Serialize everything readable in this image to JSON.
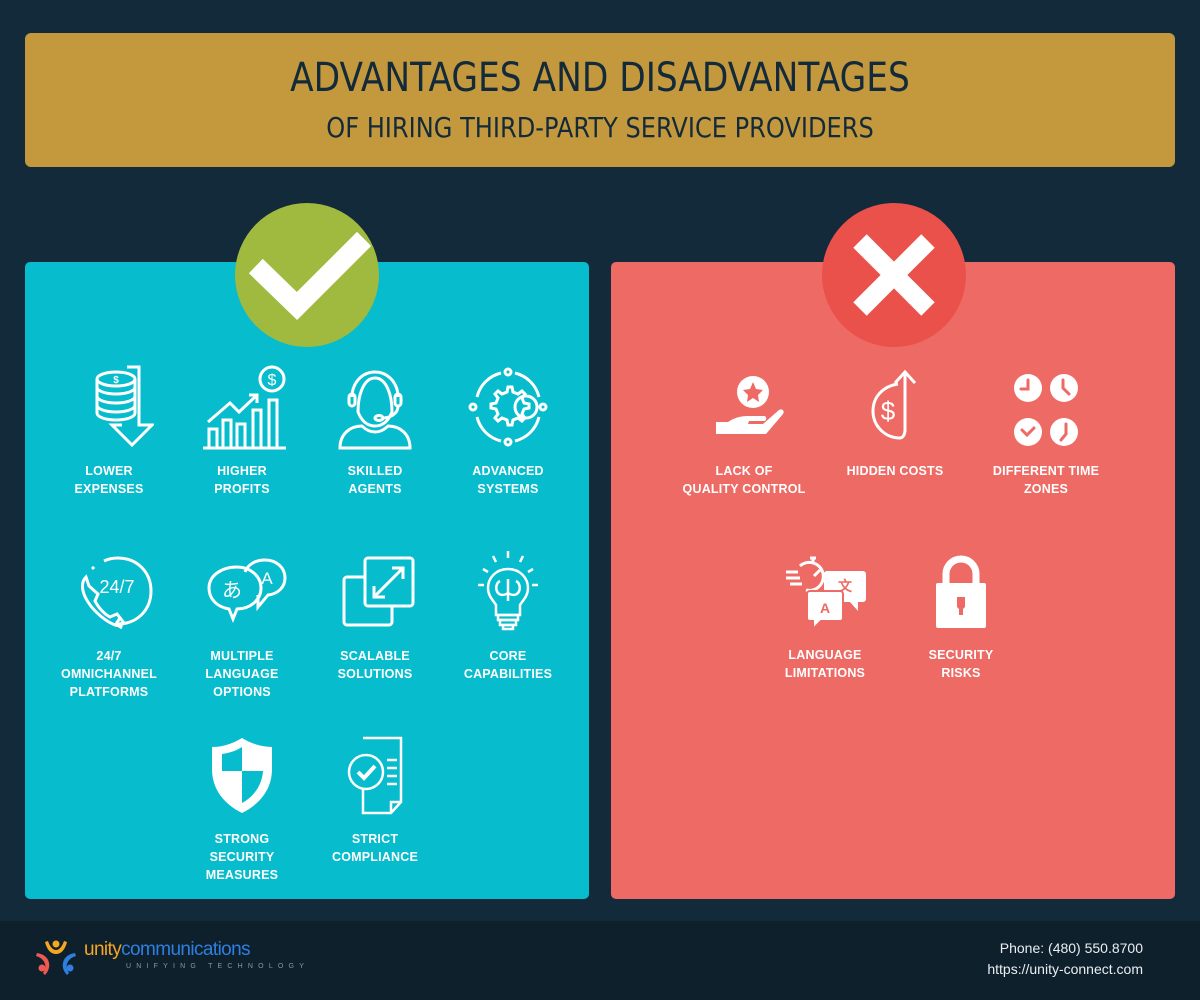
{
  "header": {
    "title": "ADVANTAGES AND DISADVANTAGES",
    "subtitle": "OF HIRING THIRD-PARTY SERVICE PROVIDERS"
  },
  "colors": {
    "background": "#132a3a",
    "header": "#c4983c",
    "pros_panel": "#07bccc",
    "cons_panel": "#ee6a64",
    "check_badge": "#9fba3e",
    "cross_badge": "#ea514a"
  },
  "pros": {
    "badge_icon": "checkmark-icon",
    "items": [
      {
        "label": "LOWER\nEXPENSES",
        "icon": "coins-down-arrow-icon"
      },
      {
        "label": "HIGHER\nPROFITS",
        "icon": "growth-chart-dollar-icon"
      },
      {
        "label": "SKILLED\nAGENTS",
        "icon": "headset-agent-icon"
      },
      {
        "label": "ADVANCED\nSYSTEMS",
        "icon": "gear-cycle-icon"
      },
      {
        "label": "24/7\nOMNICHANNEL\nPLATFORMS",
        "icon": "phone-24-7-icon"
      },
      {
        "label": "MULTIPLE\nLANGUAGE\nOPTIONS",
        "icon": "speech-bubbles-language-icon"
      },
      {
        "label": "SCALABLE\nSOLUTIONS",
        "icon": "scale-squares-icon"
      },
      {
        "label": "CORE\nCAPABILITIES",
        "icon": "lightbulb-brain-icon"
      },
      {
        "label": "STRONG\nSECURITY\nMEASURES",
        "icon": "shield-icon"
      },
      {
        "label": "STRICT\nCOMPLIANCE",
        "icon": "document-check-icon"
      }
    ]
  },
  "cons": {
    "badge_icon": "cross-icon",
    "items": [
      {
        "label": "LACK OF\nQUALITY CONTROL",
        "icon": "hand-star-icon"
      },
      {
        "label": "HIDDEN COSTS",
        "icon": "dollar-arrow-up-icon"
      },
      {
        "label": "DIFFERENT TIME\nZONES",
        "icon": "clocks-icon"
      },
      {
        "label": "LANGUAGE\nLIMITATIONS",
        "icon": "timer-translate-icon"
      },
      {
        "label": "SECURITY\nRISKS",
        "icon": "padlock-icon"
      }
    ]
  },
  "footer": {
    "brand_unity": "unity",
    "brand_comm": "communications",
    "tagline": "UNIFYING TECHNOLOGY",
    "phone": "Phone: (480) 550.8700",
    "website": "https://unity-connect.com"
  }
}
